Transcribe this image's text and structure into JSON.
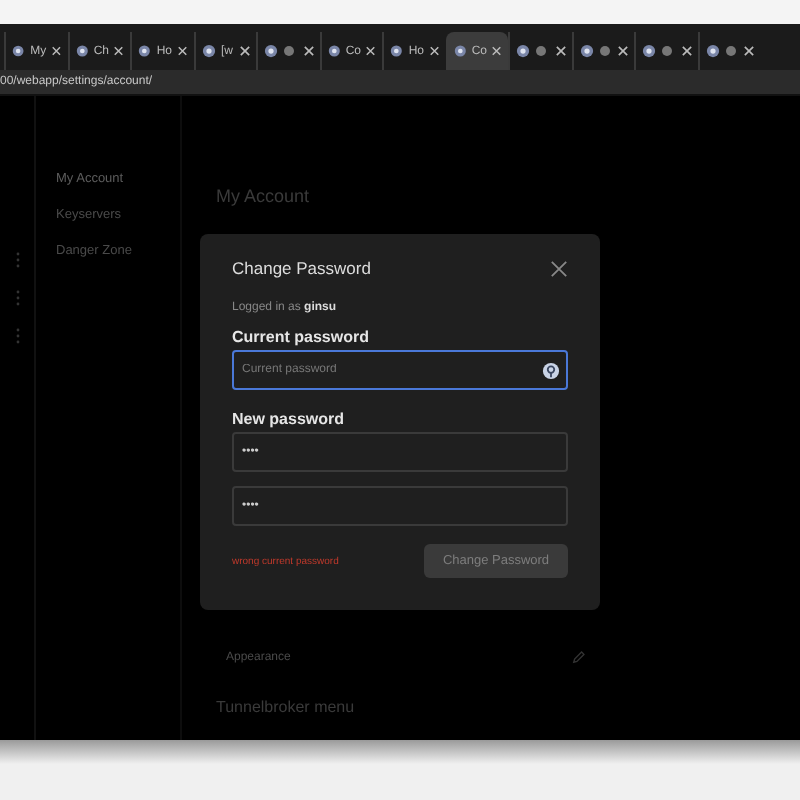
{
  "browser": {
    "tabs": [
      {
        "label": "My",
        "selected": false
      },
      {
        "label": "Ch",
        "selected": false
      },
      {
        "label": "Ho",
        "selected": false
      },
      {
        "label": "[w",
        "selected": false
      },
      {
        "selected": false
      },
      {
        "label": "Co",
        "selected": false
      },
      {
        "label": "Ho",
        "selected": false
      },
      {
        "label": "Co",
        "selected": true
      },
      {
        "selected": false
      },
      {
        "selected": false
      },
      {
        "selected": false
      },
      {
        "selected": false
      }
    ],
    "address": "00/webapp/settings/account/"
  },
  "sidebar": {
    "items": [
      {
        "label": "My Account",
        "selected": true
      },
      {
        "label": "Keyservers",
        "selected": false
      },
      {
        "label": "Danger Zone",
        "selected": false
      }
    ]
  },
  "page": {
    "heading": "My Account",
    "appearance": "Appearance",
    "section": "Tunnelbroker menu"
  },
  "dialog": {
    "title": "Change Password",
    "logged_in": "Logged in as **ginsu**",
    "current_label": "Current password",
    "current_placeholder": "Current password",
    "new_label": "New password",
    "new_value": "••••",
    "confirm_value": "••••",
    "error": "wrong current password",
    "submit": {
      "label": "Change Password",
      "disabled": true
    }
  }
}
